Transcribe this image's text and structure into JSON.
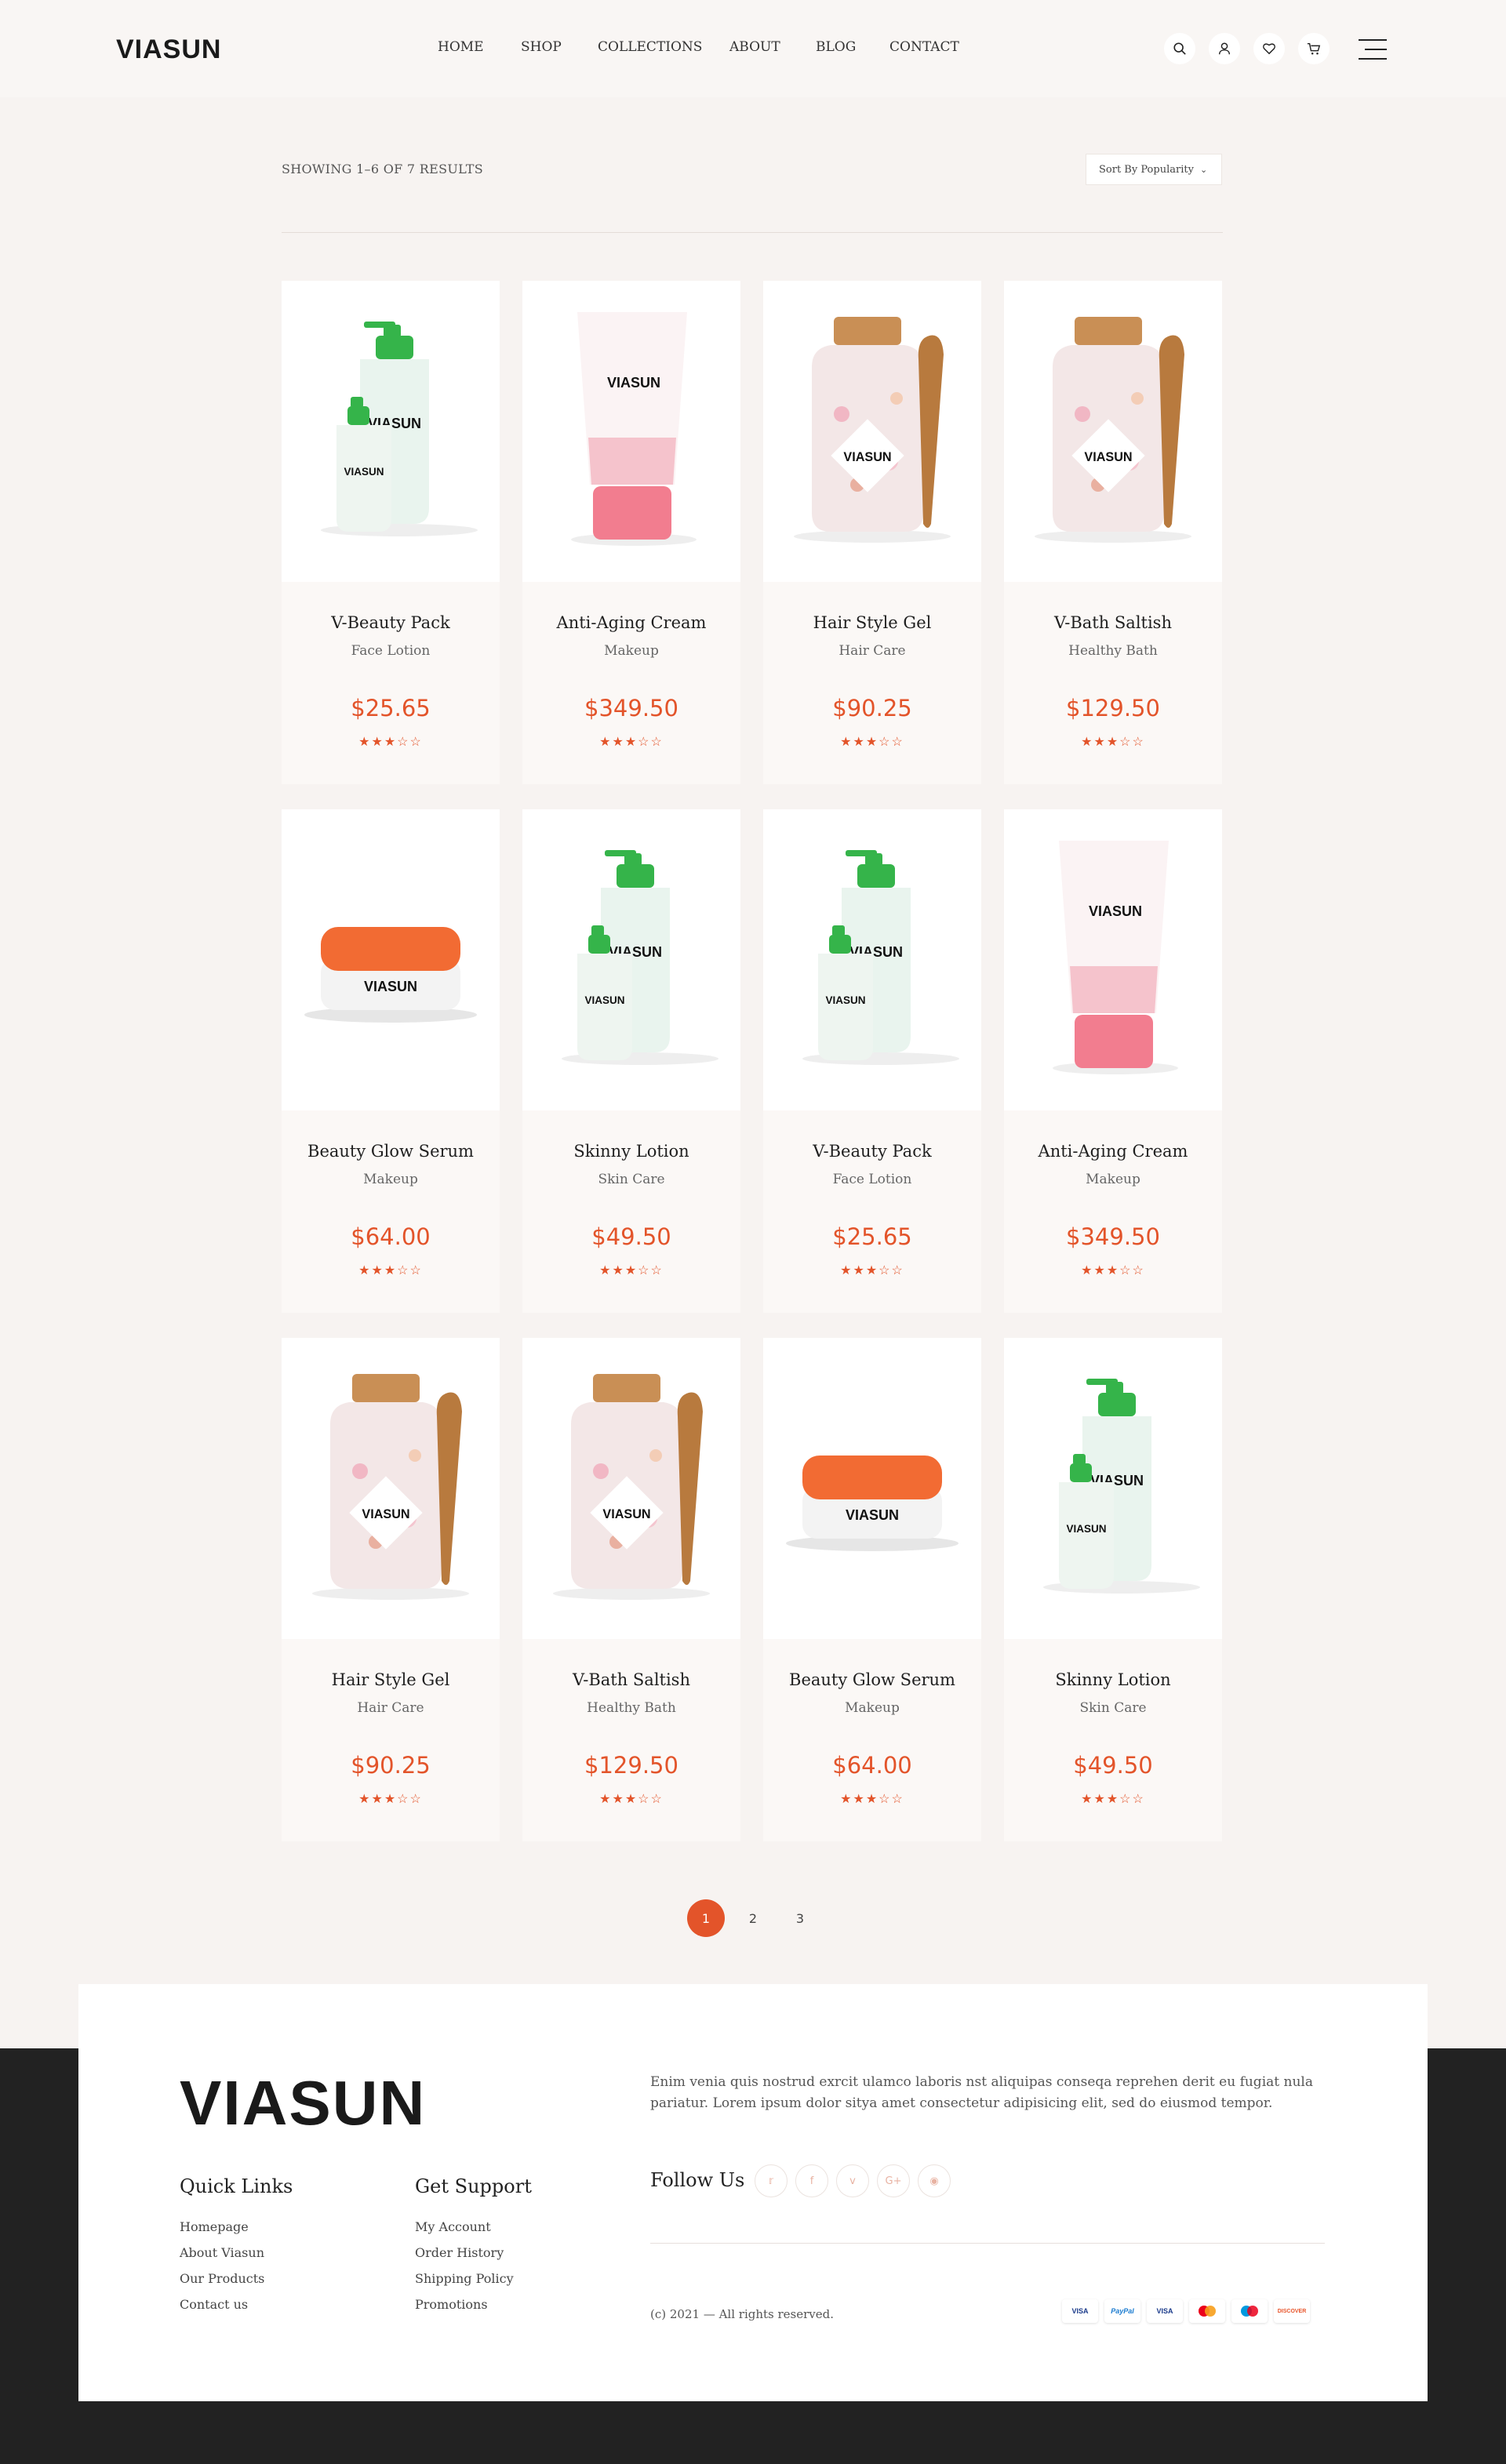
{
  "brand": {
    "logo_text": "VIASUN",
    "accent": "#e3542a"
  },
  "nav": [
    "HOME",
    "SHOP",
    "COLLECTIONS",
    "ABOUT",
    "BLOG",
    "CONTACT"
  ],
  "header_icons": [
    "search-icon",
    "user-icon",
    "heart-icon",
    "cart-icon"
  ],
  "toolbar": {
    "results_text": "SHOWING 1–6 OF 7 RESULTS",
    "sort_label": "Sort By Popularity"
  },
  "products": [
    {
      "name": "V-Beauty Pack",
      "category": "Face Lotion",
      "price": "$25.65",
      "rating": 3,
      "image": "pump-bottles"
    },
    {
      "name": "Anti-Aging Cream",
      "category": "Makeup",
      "price": "$349.50",
      "rating": 3,
      "image": "tube"
    },
    {
      "name": "Hair Style Gel",
      "category": "Hair Care",
      "price": "$90.25",
      "rating": 3,
      "image": "salt-jar"
    },
    {
      "name": "V-Bath Saltish",
      "category": "Healthy Bath",
      "price": "$129.50",
      "rating": 3,
      "image": "salt-jar"
    },
    {
      "name": "Beauty Glow Serum",
      "category": "Makeup",
      "price": "$64.00",
      "rating": 3,
      "image": "cream-jar"
    },
    {
      "name": "Skinny Lotion",
      "category": "Skin Care",
      "price": "$49.50",
      "rating": 3,
      "image": "pump-bottles"
    },
    {
      "name": "V-Beauty Pack",
      "category": "Face Lotion",
      "price": "$25.65",
      "rating": 3,
      "image": "pump-bottles"
    },
    {
      "name": "Anti-Aging Cream",
      "category": "Makeup",
      "price": "$349.50",
      "rating": 3,
      "image": "tube"
    },
    {
      "name": "Hair Style Gel",
      "category": "Hair Care",
      "price": "$90.25",
      "rating": 3,
      "image": "salt-jar"
    },
    {
      "name": "V-Bath Saltish",
      "category": "Healthy Bath",
      "price": "$129.50",
      "rating": 3,
      "image": "salt-jar"
    },
    {
      "name": "Beauty Glow Serum",
      "category": "Makeup",
      "price": "$64.00",
      "rating": 3,
      "image": "cream-jar"
    },
    {
      "name": "Skinny Lotion",
      "category": "Skin Care",
      "price": "$49.50",
      "rating": 3,
      "image": "pump-bottles"
    }
  ],
  "product_label": "VIASUN",
  "pagination": {
    "pages": [
      "1",
      "2",
      "3"
    ],
    "current": "1"
  },
  "footer": {
    "logo_text": "VIASUN",
    "about": "Enim venia quis nostrud exrcit ulamco laboris nst aliquipas conseqa reprehen derit eu fugiat nula pariatur. Lorem ipsum dolor sitya amet consectetur adipisicing elit, sed do eiusmod tempor.",
    "quick_links_title": "Quick Links",
    "quick_links": [
      "Homepage",
      "About Viasun",
      "Our Products",
      "Contact us"
    ],
    "support_title": "Get Support",
    "support_links": [
      "My Account",
      "Order History",
      "Shipping Policy",
      "Promotions"
    ],
    "follow_title": "Follow Us",
    "socials": [
      "twitter-icon",
      "facebook-icon",
      "vimeo-icon",
      "google-plus-icon",
      "instagram-icon"
    ],
    "copyright": "(c) 2021 — All rights reserved.",
    "payments": [
      "VISA",
      "PayPal",
      "VISA",
      "mastercard",
      "maestro",
      "DISCOVER"
    ]
  }
}
